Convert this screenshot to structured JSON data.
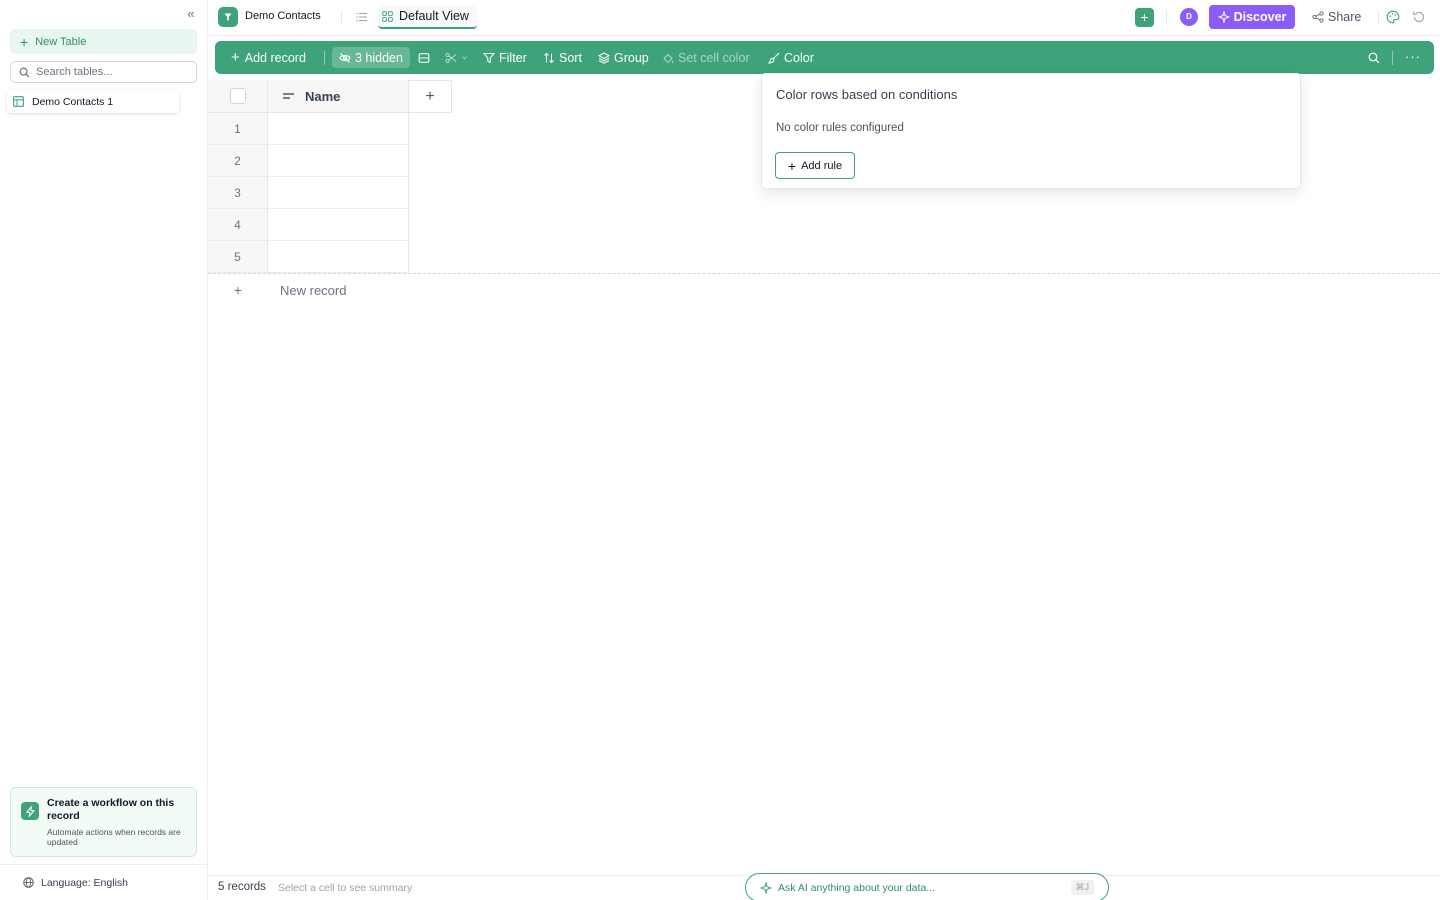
{
  "sidebar": {
    "new_table_label": "New Table",
    "search_placeholder": "Search tables...",
    "tables": [
      {
        "label": "Demo Contacts 1"
      }
    ],
    "workflow": {
      "title": "Create a workflow on this record",
      "description": "Automate actions when records are updated"
    },
    "language_label": "Language: English"
  },
  "topbar": {
    "app_title": "Demo Contacts",
    "view_name": "Default View",
    "avatar_initial": "D",
    "discover_label": "Discover",
    "share_label": "Share"
  },
  "toolbar": {
    "add_record_label": "Add record",
    "hidden_label": "3 hidden",
    "filter_label": "Filter",
    "sort_label": "Sort",
    "group_label": "Group",
    "set_cell_color_label": "Set cell color",
    "color_label": "Color"
  },
  "grid": {
    "columns": [
      {
        "name": "Name"
      }
    ],
    "rows": [
      {
        "num": "1",
        "name": ""
      },
      {
        "num": "2",
        "name": ""
      },
      {
        "num": "3",
        "name": ""
      },
      {
        "num": "4",
        "name": ""
      },
      {
        "num": "5",
        "name": ""
      }
    ],
    "new_record_label": "New record"
  },
  "color_popover": {
    "title": "Color rows based on conditions",
    "empty_text": "No color rules configured",
    "add_rule_label": "Add rule"
  },
  "footer": {
    "records_count": "5 records",
    "summary_hint": "Select a cell to see summary",
    "ask_ai_placeholder": "Ask AI anything about your data...",
    "ask_ai_shortcut": "⌘J"
  },
  "colors": {
    "accent": "#3ea37a",
    "discover": "#8b5cf6"
  },
  "icons": [
    "collapse-icon",
    "plus-icon",
    "search-icon",
    "table-icon",
    "bolt-icon",
    "globe-icon",
    "app-logo-icon",
    "list-icon",
    "grid-view-icon",
    "sparkle-icon",
    "share-icon",
    "palette-icon",
    "refresh-icon",
    "eye-off-icon",
    "row-height-icon",
    "scissors-icon",
    "filter-icon",
    "sort-icon",
    "layers-icon",
    "paint-bucket-icon",
    "brush-icon",
    "more-icon",
    "text-field-icon"
  ]
}
